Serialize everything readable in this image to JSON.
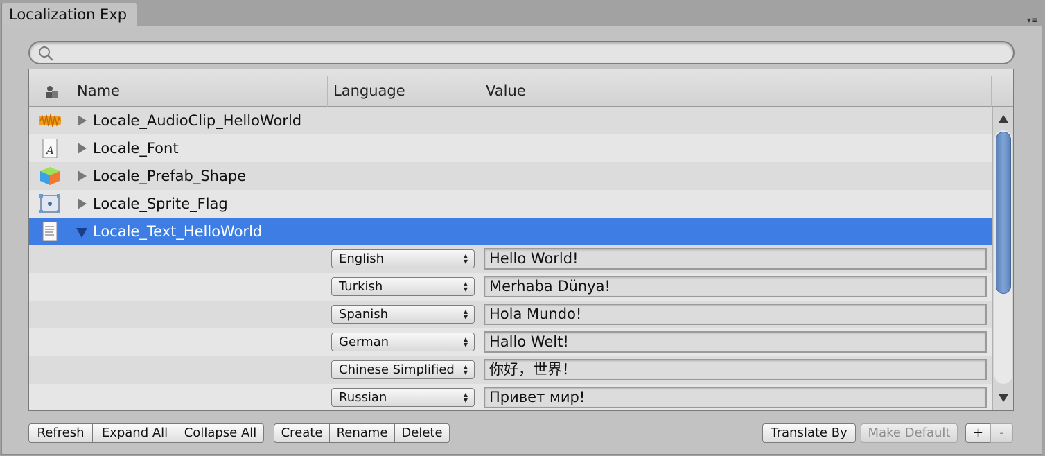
{
  "window": {
    "tab_title": "Localization Exp",
    "tab_menu_icon": "dropdown-list-icon"
  },
  "search": {
    "placeholder": "",
    "value": ""
  },
  "table": {
    "columns": [
      "Name",
      "Language",
      "Value"
    ],
    "items": [
      {
        "icon": "audio-clip-icon",
        "label": "Locale_AudioClip_HelloWorld",
        "expanded": false
      },
      {
        "icon": "font-icon",
        "label": "Locale_Font",
        "expanded": false
      },
      {
        "icon": "prefab-cube-icon",
        "label": "Locale_Prefab_Shape",
        "expanded": false
      },
      {
        "icon": "sprite-icon",
        "label": "Locale_Sprite_Flag",
        "expanded": false
      },
      {
        "icon": "text-asset-icon",
        "label": "Locale_Text_HelloWorld",
        "expanded": true,
        "selected": true
      }
    ],
    "translations": [
      {
        "language": "English",
        "value": "Hello World!"
      },
      {
        "language": "Turkish",
        "value": "Merhaba Dünya!"
      },
      {
        "language": "Spanish",
        "value": "Hola Mundo!"
      },
      {
        "language": "German",
        "value": "Hallo Welt!"
      },
      {
        "language": "Chinese Simplified",
        "value": "你好，世界！"
      },
      {
        "language": "Russian",
        "value": "Привет мир!"
      }
    ]
  },
  "toolbar": {
    "refresh": "Refresh",
    "expand_all": "Expand All",
    "collapse_all": "Collapse All",
    "create": "Create",
    "rename": "Rename",
    "delete": "Delete",
    "translate_by": "Translate By",
    "make_default": "Make Default",
    "add": "+",
    "remove": "-"
  },
  "colors": {
    "selection": "#3e7de3",
    "panel_bg": "#c2c2c2"
  }
}
